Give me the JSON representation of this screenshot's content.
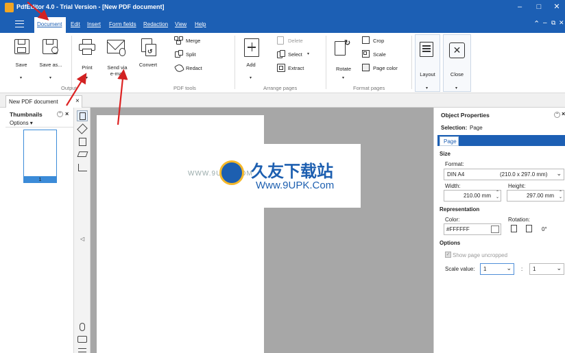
{
  "app": {
    "title": "PdfEditor 4.0 - Trial Version - [New PDF document]",
    "window_controls": [
      "–",
      "□",
      "✕"
    ],
    "mdi_controls": [
      "⌃",
      "–",
      "⧉",
      "✕"
    ]
  },
  "menu": {
    "items": [
      "Document",
      "Edit",
      "Insert",
      "Form fields",
      "Redaction",
      "View",
      "Help"
    ]
  },
  "ribbon": {
    "save": "Save",
    "save_as": "Save as...",
    "print": "Print",
    "send_line1": "Send via",
    "send_line2": "e-mail",
    "convert": "Convert",
    "merge": "Merge",
    "split": "Split",
    "redact": "Redact",
    "add": "Add",
    "delete": "Delete",
    "select": "Select",
    "extract": "Extract",
    "rotate": "Rotate",
    "crop": "Crop",
    "scale": "Scale",
    "page_color": "Page color",
    "layout": "Layout",
    "close": "Close",
    "groups": {
      "output": "Output",
      "pdf_tools": "PDF tools",
      "arrange_pages": "Arrange pages",
      "format_pages": "Format pages"
    }
  },
  "doc_tab": {
    "label": "New PDF document",
    "close": "×"
  },
  "thumbnails": {
    "title": "Thumbnails",
    "options": "Options ▾",
    "page_number": "1"
  },
  "watermark": {
    "left_text": "WWW.9UPK.COM",
    "cn_text": "久友下载站",
    "url_text": "Www.9UPK.Com"
  },
  "properties": {
    "title": "Object Properties",
    "selection_label": "Selection:",
    "selection_value": "Page",
    "tab": "Page",
    "size_section": "Size",
    "format_label": "Format:",
    "format_value": "DIN A4",
    "format_dims": "(210.0 x 297.0 mm)",
    "width_label": "Width:",
    "width_value": "210.00 mm",
    "height_label": "Height:",
    "height_value": "297.00 mm",
    "representation_section": "Representation",
    "color_label": "Color:",
    "color_value": "#FFFFFF",
    "rotation_label": "Rotation:",
    "rotation_value": "0°",
    "options_section": "Options",
    "show_uncropped": "Show page uncropped",
    "scale_label": "Scale value:",
    "scale_value_1": "1",
    "scale_sep": ":",
    "scale_value_2": "1"
  },
  "colors": {
    "brand_blue": "#1c5fb4",
    "canvas_gray": "#a7a7a7",
    "annotation_red": "#d22222"
  }
}
